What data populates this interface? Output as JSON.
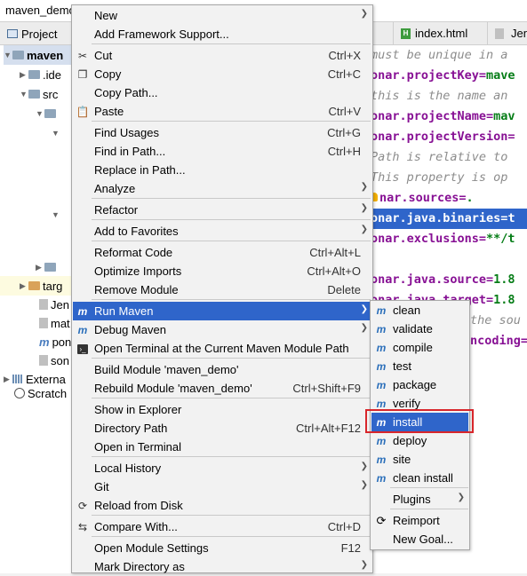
{
  "window": {
    "title": "maven_demo"
  },
  "toolbar": {
    "project_label": "Project"
  },
  "tabs": [
    {
      "label": "index.html"
    },
    {
      "label": "Jen"
    }
  ],
  "tree": {
    "items": [
      {
        "label": "maven",
        "depth": 0,
        "expanded": true
      },
      {
        "label": ".ide",
        "depth": 1,
        "expanded": false
      },
      {
        "label": "src",
        "depth": 1,
        "expanded": true
      },
      {
        "label": "targ",
        "depth": 1,
        "expanded": false
      },
      {
        "label": "Jen",
        "depth": 1
      },
      {
        "label": "mat",
        "depth": 1
      },
      {
        "label": "pon",
        "depth": 1
      },
      {
        "label": "son",
        "depth": 1
      },
      {
        "label": "Externa",
        "depth": 0
      },
      {
        "label": "Scratch",
        "depth": 0
      }
    ]
  },
  "editor": {
    "lines": [
      "must be unique in a",
      "onar.projectKey=mave",
      " this is the name an",
      "onar.projectName=mav",
      "onar.projectVersion=",
      " Path is relative to",
      " This property is op",
      "nar.sources=.",
      "onar.java.binaries=t",
      "onar.exclusions=**/t",
      "",
      "onar.java.source=1.8",
      "onar.java.target=1.8",
      " the sou",
      "ncoding="
    ]
  },
  "context_menu": {
    "items": [
      {
        "label": "New",
        "shortcut": "",
        "submenu": true
      },
      {
        "label": "Add Framework Support...",
        "shortcut": ""
      },
      {
        "label": "Cut",
        "shortcut": "Ctrl+X"
      },
      {
        "label": "Copy",
        "shortcut": "Ctrl+C"
      },
      {
        "label": "Copy Path...",
        "shortcut": ""
      },
      {
        "label": "Paste",
        "shortcut": "Ctrl+V"
      },
      {
        "label": "Find Usages",
        "shortcut": "Ctrl+G"
      },
      {
        "label": "Find in Path...",
        "shortcut": "Ctrl+H"
      },
      {
        "label": "Replace in Path...",
        "shortcut": ""
      },
      {
        "label": "Analyze",
        "shortcut": "",
        "submenu": true
      },
      {
        "label": "Refactor",
        "shortcut": "",
        "submenu": true
      },
      {
        "label": "Add to Favorites",
        "shortcut": "",
        "submenu": true
      },
      {
        "label": "Reformat Code",
        "shortcut": "Ctrl+Alt+L"
      },
      {
        "label": "Optimize Imports",
        "shortcut": "Ctrl+Alt+O"
      },
      {
        "label": "Remove Module",
        "shortcut": "Delete"
      },
      {
        "label": "Run Maven",
        "shortcut": "",
        "submenu": true,
        "highlighted": true
      },
      {
        "label": "Debug Maven",
        "shortcut": "",
        "submenu": true
      },
      {
        "label": "Open Terminal at the Current Maven Module Path",
        "shortcut": ""
      },
      {
        "label": "Build Module 'maven_demo'",
        "shortcut": ""
      },
      {
        "label": "Rebuild Module 'maven_demo'",
        "shortcut": "Ctrl+Shift+F9"
      },
      {
        "label": "Show in Explorer",
        "shortcut": ""
      },
      {
        "label": "Directory Path",
        "shortcut": "Ctrl+Alt+F12"
      },
      {
        "label": "Open in Terminal",
        "shortcut": ""
      },
      {
        "label": "Local History",
        "shortcut": "",
        "submenu": true
      },
      {
        "label": "Git",
        "shortcut": "",
        "submenu": true
      },
      {
        "label": "Reload from Disk",
        "shortcut": ""
      },
      {
        "label": "Compare With...",
        "shortcut": "Ctrl+D"
      },
      {
        "label": "Open Module Settings",
        "shortcut": "F12"
      },
      {
        "label": "Mark Directory as",
        "shortcut": "",
        "submenu": true
      }
    ]
  },
  "submenu": {
    "items": [
      {
        "label": "clean"
      },
      {
        "label": "validate"
      },
      {
        "label": "compile"
      },
      {
        "label": "test"
      },
      {
        "label": "package"
      },
      {
        "label": "verify"
      },
      {
        "label": "install",
        "highlighted": true
      },
      {
        "label": "deploy"
      },
      {
        "label": "site"
      },
      {
        "label": "clean install"
      },
      {
        "label": "Plugins",
        "submenu": true
      },
      {
        "label": "Reimport"
      },
      {
        "label": "New Goal..."
      }
    ]
  },
  "colors": {
    "highlight": "#2f65ca",
    "annotation_box": "#d8262b"
  }
}
